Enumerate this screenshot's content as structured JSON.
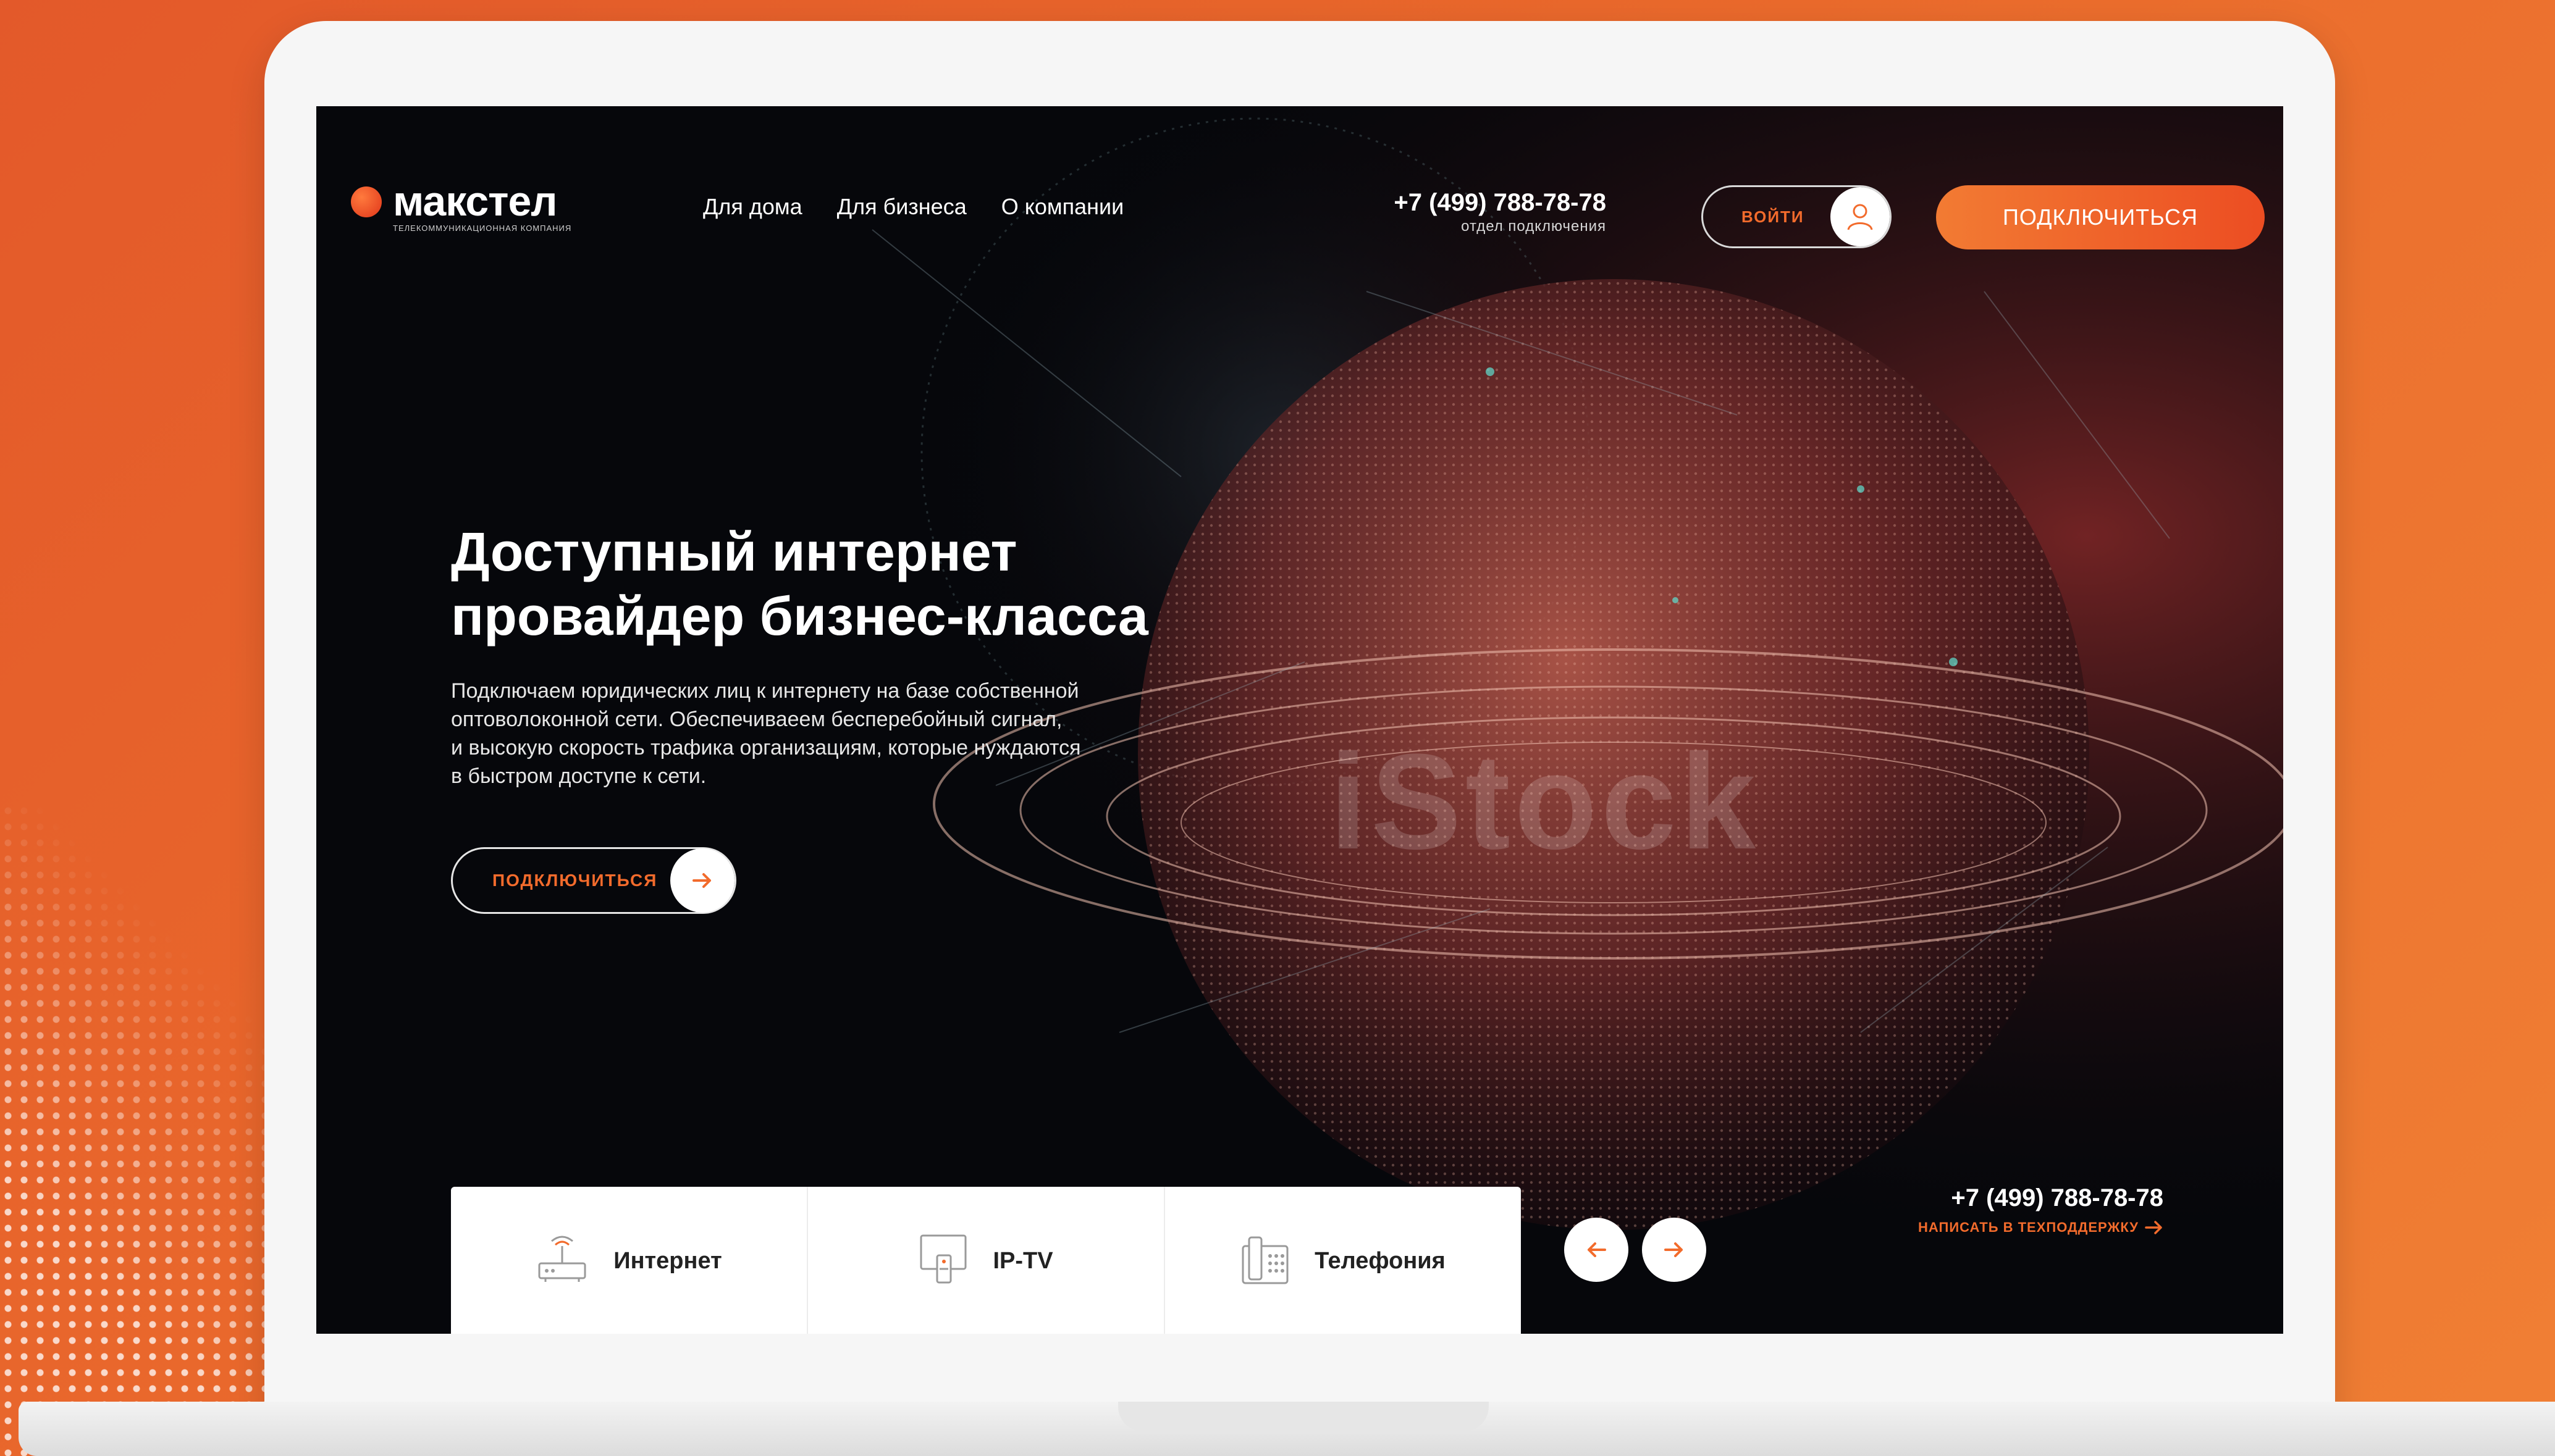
{
  "brand": {
    "name": "макстел",
    "tagline": "ТЕЛЕКОММУНИКАЦИОННАЯ КОМПАНИЯ"
  },
  "nav": {
    "items": [
      {
        "label": "Для дома"
      },
      {
        "label": "Для бизнеса"
      },
      {
        "label": "О компании"
      }
    ]
  },
  "header": {
    "phone": "+7 (499) 788-78-78",
    "phone_caption": "отдел подключения",
    "login_label": "ВОЙТИ",
    "connect_label": "ПОДКЛЮЧИТЬСЯ"
  },
  "hero": {
    "title_line1": "Доступный интернет",
    "title_line2": "провайдер бизнес-класса",
    "desc_line1": "Подключаем юридических лиц к интернету на базе собственной",
    "desc_line2": "оптоволоконной сети. Обеспечиваеем бесперебойный сигнал,",
    "desc_line3": "и высокую скорость трафика организациям, которые нуждаются",
    "desc_line4": "в быстром доступе к сети.",
    "cta_label": "ПОДКЛЮЧИТЬСЯ",
    "watermark": "iStock"
  },
  "services": {
    "tabs": [
      {
        "label": "Интернет",
        "icon": "router-icon"
      },
      {
        "label": "IP-TV",
        "icon": "tv-icon"
      },
      {
        "label": "Телефония",
        "icon": "phone-icon"
      }
    ]
  },
  "support": {
    "phone": "+7 (499) 788-78-78",
    "link_label": "НАПИСАТЬ В ТЕХПОДДЕРЖКУ"
  },
  "colors": {
    "accent": "#f26b2c",
    "background_orange": "#e8622b",
    "screen_dark": "#06070b"
  }
}
